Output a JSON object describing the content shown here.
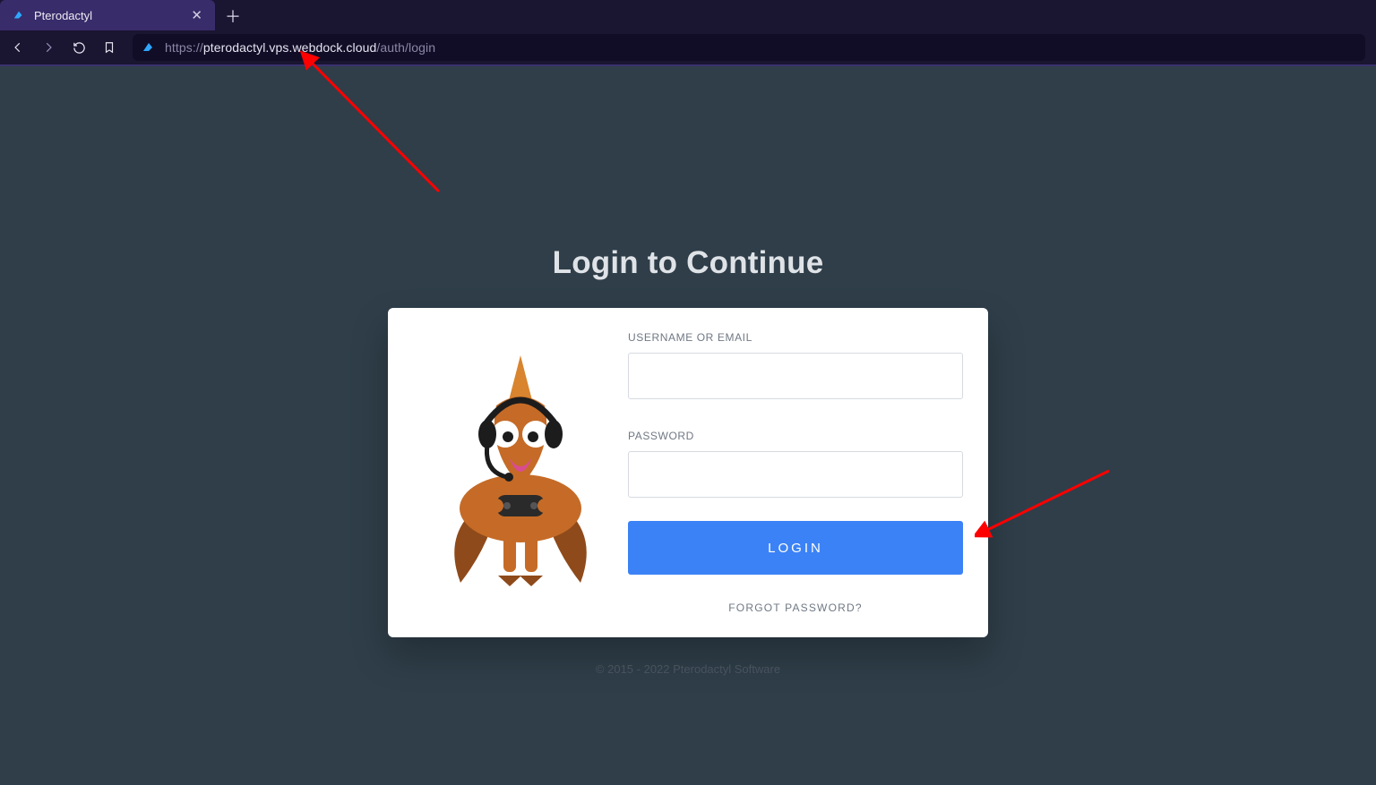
{
  "browser": {
    "tab_title": "Pterodactyl",
    "url": {
      "scheme": "https://",
      "host": "pterodactyl.vps.webdock.cloud",
      "path": "/auth/login"
    },
    "icons": {
      "back": "back-icon",
      "forward": "forward-icon",
      "reload": "reload-icon",
      "bookmark": "bookmark-icon",
      "close_tab": "✕",
      "new_tab": "＋"
    }
  },
  "page": {
    "title": "Login to Continue",
    "username_label": "USERNAME OR EMAIL",
    "username_value": "",
    "password_label": "PASSWORD",
    "password_value": "",
    "login_button": "LOGIN",
    "forgot_link": "FORGOT PASSWORD?",
    "footer": "© 2015 - 2022 Pterodactyl Software"
  },
  "annotations": {
    "arrow_to_url": true,
    "arrow_to_login": true
  },
  "colors": {
    "chrome_bg": "#1a1531",
    "chrome_active_tab": "#392c6a",
    "chrome_border": "#3b316e",
    "page_bg": "#2f3e49",
    "card_bg": "#ffffff",
    "primary_button": "#3b82f6",
    "input_border": "#d6dadf",
    "muted_text": "#6f7884",
    "mascot_body": "#c56b27",
    "mascot_wing": "#8e4a1a",
    "mascot_crest": "#d9842e",
    "arrow": "#ff0000"
  }
}
